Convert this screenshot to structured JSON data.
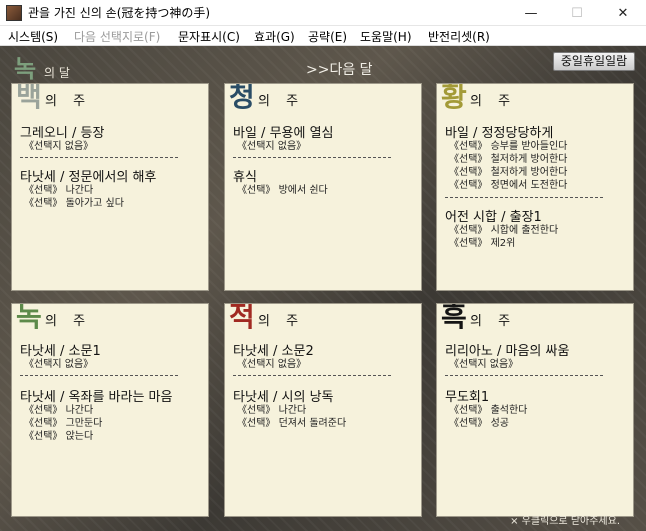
{
  "window": {
    "title": "관을 가진 신의 손(冠を持つ神の手)",
    "minimize_icon": "—",
    "maximize_icon": "☐",
    "close_icon": "✕"
  },
  "menu": [
    {
      "label": "시스템(S)",
      "enabled": true
    },
    {
      "label": "다음 선택지로(F)",
      "enabled": false
    },
    {
      "label": "문자표시(C)",
      "enabled": true
    },
    {
      "label": "효과(G)",
      "enabled": true
    },
    {
      "label": "공략(E)",
      "enabled": true
    },
    {
      "label": "도움말(H)",
      "enabled": true
    },
    {
      "label": "반전리셋(R)",
      "enabled": true
    }
  ],
  "header": {
    "month_char": "녹",
    "month_suffix": "의 달",
    "next_month": ">>다음 달",
    "holiday_button": "중일휴일일람"
  },
  "panels": [
    {
      "big_char": "백",
      "color": "#9aa39a",
      "head": "의 주",
      "items": [
        {
          "title": "그레오니 / 등장",
          "choices": [
            "《선택지 없음》"
          ]
        },
        {
          "title": "타낫세 / 정문에서의 해후",
          "choices": [
            "《선택》 나간다",
            "《선택》 돌아가고 싶다"
          ]
        }
      ]
    },
    {
      "big_char": "청",
      "color": "#2a4d66",
      "head": "의 주",
      "items": [
        {
          "title": "바일 / 무용에 열심",
          "choices": [
            "《선택지 없음》"
          ]
        },
        {
          "title": "휴식",
          "choices": [
            "《선택》 방에서 쉰다"
          ]
        }
      ]
    },
    {
      "big_char": "황",
      "color": "#a39a37",
      "head": "의 주",
      "items": [
        {
          "title": "바일 / 정정당당하게",
          "choices": [
            "《선택》 승부를 받아들인다",
            "《선택》 철저하게 방어한다",
            "《선택》 철저하게 방어한다",
            "《선택》 정면에서 도전한다"
          ]
        },
        {
          "title": "어전 시합 / 출장1",
          "choices": [
            "《선택》 시합에 출전한다",
            "《선택》 제2위"
          ]
        }
      ]
    },
    {
      "big_char": "녹",
      "color": "#5d8a4a",
      "head": "의 주",
      "items": [
        {
          "title": "타낫세 / 소문1",
          "choices": [
            "《선택지 없음》"
          ]
        },
        {
          "title": "타낫세 / 옥좌를 바라는 마음",
          "choices": [
            "《선택》 나간다",
            "《선택》 그만둔다",
            "《선택》 앉는다"
          ]
        }
      ]
    },
    {
      "big_char": "적",
      "color": "#a12a22",
      "head": "의 주",
      "items": [
        {
          "title": "타낫세 / 소문2",
          "choices": [
            "《선택지 없음》"
          ]
        },
        {
          "title": "타낫세 / 시의 낭독",
          "choices": [
            "《선택》 나간다",
            "《선택》 던져서 돌려준다"
          ]
        }
      ]
    },
    {
      "big_char": "흑",
      "color": "#151515",
      "head": "의 주",
      "items": [
        {
          "title": "리리아노 / 마음의 싸움",
          "choices": [
            "《선택지 없음》"
          ]
        },
        {
          "title": "무도회1",
          "choices": [
            "《선택》 출석한다",
            "《선택》 성공"
          ]
        }
      ]
    }
  ],
  "status": "× 우클릭으로 닫아주세요."
}
